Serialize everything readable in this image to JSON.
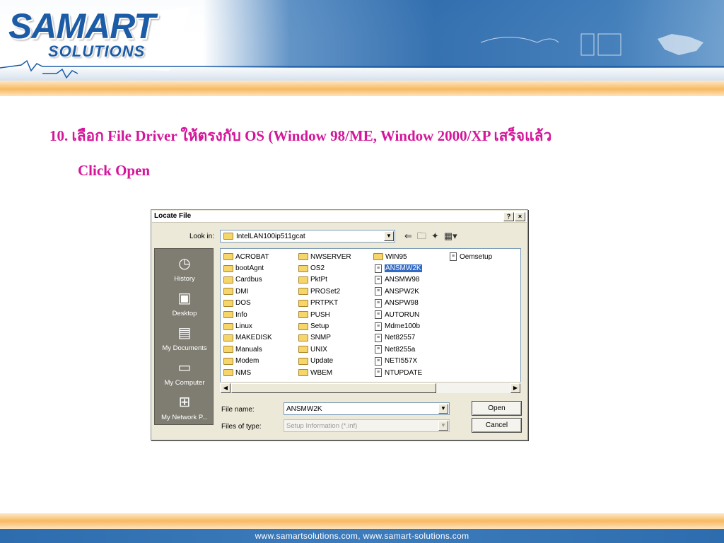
{
  "header": {
    "logo_main": "SAMART",
    "logo_sub": "SOLUTIONS"
  },
  "slide": {
    "instruction_line1": "10. เลือก File Driver ให้ตรงกับ OS (Window 98/ME, Window 2000/XP เสร็จแล้ว",
    "instruction_line2": "Click Open"
  },
  "dialog": {
    "title": "Locate File",
    "help_button": "?",
    "close_button": "×",
    "look_in_label": "Look in:",
    "look_in_value": "IntelLAN100ip511gcat",
    "places": [
      {
        "label": "History",
        "icon": "history-icon"
      },
      {
        "label": "Desktop",
        "icon": "desktop-icon"
      },
      {
        "label": "My Documents",
        "icon": "my-documents-icon"
      },
      {
        "label": "My Computer",
        "icon": "my-computer-icon"
      },
      {
        "label": "My Network P...",
        "icon": "my-network-icon"
      }
    ],
    "columns": [
      {
        "items": [
          {
            "name": "ACROBAT",
            "type": "folder"
          },
          {
            "name": "bootAgnt",
            "type": "folder"
          },
          {
            "name": "Cardbus",
            "type": "folder"
          },
          {
            "name": "DMI",
            "type": "folder"
          },
          {
            "name": "DOS",
            "type": "folder"
          },
          {
            "name": "Info",
            "type": "folder"
          },
          {
            "name": "Linux",
            "type": "folder"
          },
          {
            "name": "MAKEDISK",
            "type": "folder"
          },
          {
            "name": "Manuals",
            "type": "folder"
          },
          {
            "name": "Modem",
            "type": "folder"
          },
          {
            "name": "NMS",
            "type": "folder"
          }
        ]
      },
      {
        "items": [
          {
            "name": "NWSERVER",
            "type": "folder"
          },
          {
            "name": "OS2",
            "type": "folder"
          },
          {
            "name": "PktPt",
            "type": "folder"
          },
          {
            "name": "PROSet2",
            "type": "folder"
          },
          {
            "name": "PRTPKT",
            "type": "folder"
          },
          {
            "name": "PUSH",
            "type": "folder"
          },
          {
            "name": "Setup",
            "type": "folder"
          },
          {
            "name": "SNMP",
            "type": "folder"
          },
          {
            "name": "UNIX",
            "type": "folder"
          },
          {
            "name": "Update",
            "type": "folder"
          },
          {
            "name": "WBEM",
            "type": "folder"
          }
        ]
      },
      {
        "items": [
          {
            "name": "WIN95",
            "type": "folder"
          },
          {
            "name": "ANSMW2K",
            "type": "file",
            "selected": true
          },
          {
            "name": "ANSMW98",
            "type": "file"
          },
          {
            "name": "ANSPW2K",
            "type": "file"
          },
          {
            "name": "ANSPW98",
            "type": "file"
          },
          {
            "name": "AUTORUN",
            "type": "file"
          },
          {
            "name": "Mdme100b",
            "type": "file"
          },
          {
            "name": "Net82557",
            "type": "file"
          },
          {
            "name": "Net8255a",
            "type": "file"
          },
          {
            "name": "NETI557X",
            "type": "file"
          },
          {
            "name": "NTUPDATE",
            "type": "file"
          }
        ]
      },
      {
        "items": [
          {
            "name": "Oemsetup",
            "type": "file"
          }
        ]
      }
    ],
    "file_name_label": "File name:",
    "file_name_value": "ANSMW2K",
    "file_type_label": "Files of type:",
    "file_type_value": "Setup Information (*.inf)",
    "open_button": "Open",
    "cancel_button": "Cancel"
  },
  "footer": {
    "links_text": "www.samartsolutions.com,   www.samart-solutions.com"
  }
}
